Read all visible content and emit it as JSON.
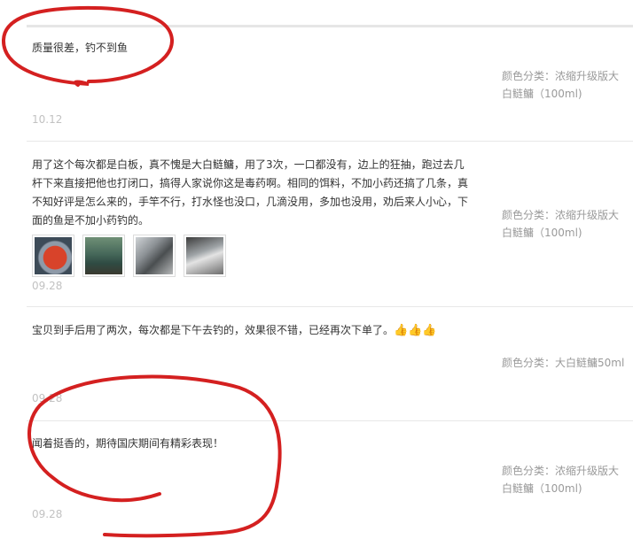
{
  "reviews": [
    {
      "text": "质量很差，钓不到鱼",
      "sku_label": "颜色分类：",
      "sku_value": "浓缩升级版大白鲢鳙（100ml)",
      "date": "10.12"
    },
    {
      "text": "用了这个每次都是白板，真不愧是大白鲢鳙，用了3次，一口都没有，边上的狂抽，跑过去几杆下来直接把他也打闭口，搞得人家说你这是毒药啊。相同的饵料，不加小药还搞了几条，真不知好评是怎么来的，手竿不行，打水怪也没口，几滴没用，多加也没用，劝后来人小心，下面的鱼是不加小药钓的。",
      "sku_label": "颜色分类：",
      "sku_value": "浓缩升级版大白鲢鳙（100ml)",
      "date": "09.28",
      "thumbnails": [
        "photo-1",
        "photo-2",
        "photo-3",
        "photo-4"
      ]
    },
    {
      "text": "宝贝到手后用了两次，每次都是下午去钓的，效果很不错，已经再次下单了。",
      "emoji": "👍👍👍",
      "sku_label": "颜色分类：",
      "sku_value": "大白鲢鳙50ml",
      "date": "09.28"
    },
    {
      "text": "闻着挺香的，期待国庆期间有精彩表现！",
      "sku_label": "颜色分类：",
      "sku_value": "浓缩升级版大白鲢鳙（100ml)",
      "date": "09.28"
    }
  ],
  "annotation_color": "#d42020"
}
